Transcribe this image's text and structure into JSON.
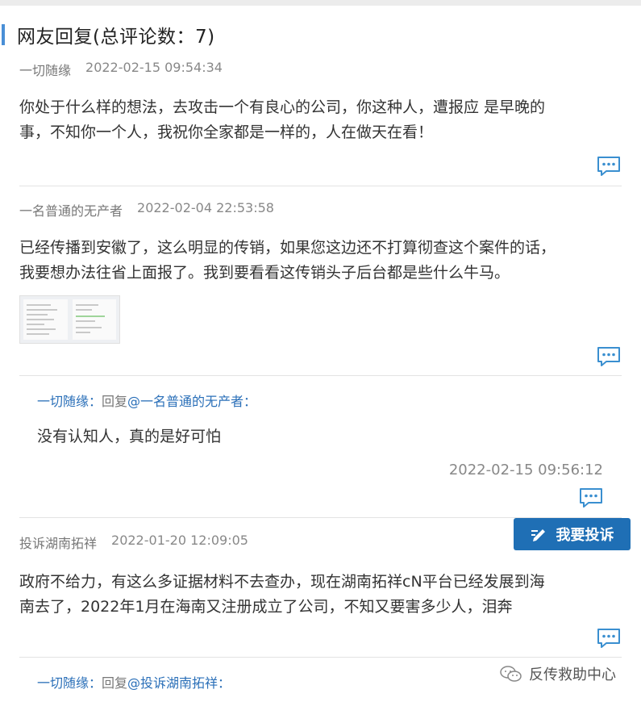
{
  "section": {
    "title": "网友回复(总评论数：7)"
  },
  "comments": [
    {
      "user": "一切随缘",
      "time": "2022-02-15 09:54:34",
      "text_line1": "你处于什么样的想法，去攻击一个有良心的公司，你这种人，遭报应 是早晚的",
      "text_line2": "事，不知你一个人，我祝你全家都是一样的，人在做天在看！"
    },
    {
      "user": "一名普通的无产者",
      "time": "2022-02-04 22:53:58",
      "text_line1": "已经传播到安徽了，这么明显的传销，如果您这边还不打算彻查这个案件的话，",
      "text_line2": "我要想办法往省上面报了。我到要看看这传销头子后台都是些什么牛马。",
      "has_image": true
    },
    {
      "user": "投诉湖南拓祥",
      "time": "2022-01-20 12:09:05",
      "text_line1": "政府不给力，有这么多证据材料不去查办，现在湖南拓祥cN平台已经发展到海",
      "text_line2": "南去了，2022年1月在海南又注册成立了公司，不知又要害多少人，泪奔"
    }
  ],
  "replies": [
    {
      "user": "一切随缘：",
      "reply_word": "回复",
      "target": "@一名普通的无产者：",
      "text": "没有认知人，真的是好可怕",
      "time": "2022-02-15 09:56:12"
    },
    {
      "user": "一切随缘：",
      "reply_word": "回复",
      "target": "@投诉湖南拓祥："
    }
  ],
  "complain_button": {
    "label": "我要投诉"
  },
  "watermark": {
    "text": "反传救助中心"
  },
  "colors": {
    "accent": "#4a8fd6",
    "button": "#1f6fb5",
    "link": "#2a6fb8",
    "icon": "#3a8fd0"
  },
  "icons": [
    "comment-bubble-icon",
    "pen-icon",
    "wechat-icon"
  ]
}
